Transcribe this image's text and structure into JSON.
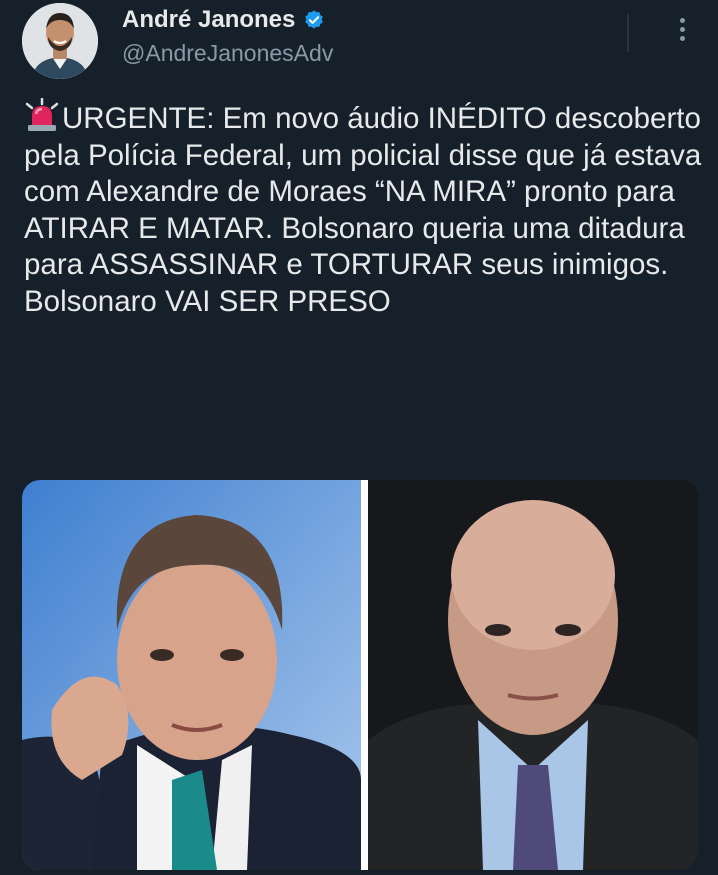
{
  "author": {
    "name": "André Janones",
    "handle": "@AndreJanonesAdv",
    "verified": true
  },
  "tweet": {
    "lines": [
      "URGENTE: Em novo áudio INÉDITO descoberto pela Polícia Federal, um policial disse que já estava com Alexandre de Moraes “NA MIRA” pronto para ATIRAR E MATAR. Bolsonaro queria uma ditadura para ASSASSINAR e TORTURAR seus inimigos.",
      "Bolsonaro VAI SER PRESO"
    ],
    "leading_icon": "rotating-light-emoji"
  },
  "media": {
    "left_photo": "man-blue-background-hand-behind-neck",
    "right_photo": "bald-man-dark-background"
  },
  "icons": {
    "more": "more-vertical-icon",
    "verified": "verified-badge-icon"
  },
  "colors": {
    "background": "#15202b",
    "text": "#e7e9ea",
    "muted": "#8b98a5",
    "verified": "#1d9bf0"
  }
}
